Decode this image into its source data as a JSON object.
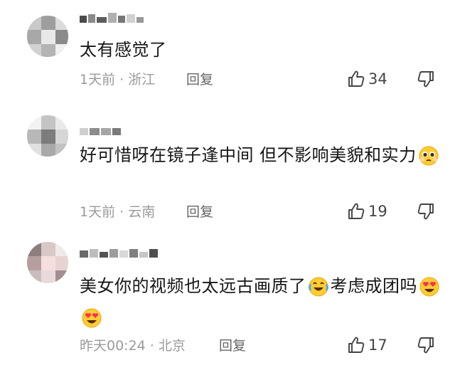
{
  "comments": [
    {
      "text": "太有感觉了",
      "time": "1天前",
      "location": "浙江",
      "reply_label": "回复",
      "likes": "34"
    },
    {
      "text": "好可惜呀在镜子逢中间 但不影响美貌和实力",
      "emoji": "pleading-face-emoji",
      "time": "1天前",
      "location": "云南",
      "reply_label": "回复",
      "likes": "19"
    },
    {
      "text": "美女你的视频也太远古画质了",
      "text2": "考虑成团吗",
      "emoji": "laughing-crying-face-emoji",
      "emoji_end": "heart-eyes-face-emoji",
      "time": "昨天00:24",
      "location": "北京",
      "reply_label": "回复",
      "likes": "17"
    }
  ],
  "separator": " · ",
  "colors": {
    "text": "#161616",
    "meta": "#9a9a9a",
    "reply": "#666666",
    "icon": "#444444"
  }
}
